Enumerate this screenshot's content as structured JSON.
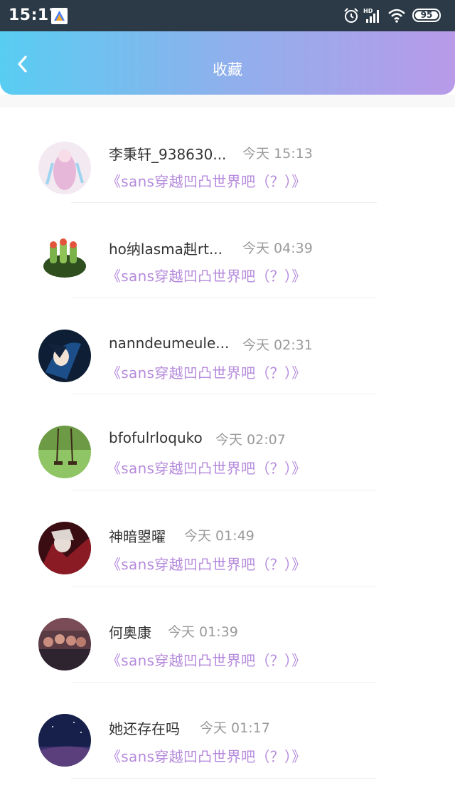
{
  "status_bar": {
    "time": "15:17",
    "signal_label": "HD",
    "battery": "95"
  },
  "header": {
    "title": "收藏",
    "back_icon": "chevron-left-icon"
  },
  "items": [
    {
      "name": "李秉轩_938630...",
      "time": "今天 15:13",
      "title": "《sans穿越凹凸世界吧（？）》"
    },
    {
      "name": "ho纳lasma赳rt...",
      "time": "今天 04:39",
      "title": "《sans穿越凹凸世界吧（？）》"
    },
    {
      "name": "nanndeumeule...",
      "time": "今天 02:31",
      "title": "《sans穿越凹凸世界吧（？）》"
    },
    {
      "name": "bfofulrloquko",
      "time": "今天 02:07",
      "title": "《sans穿越凹凸世界吧（？）》"
    },
    {
      "name": "神暗曌曜",
      "time": "今天 01:49",
      "title": "《sans穿越凹凸世界吧（？）》"
    },
    {
      "name": "何奥康",
      "time": "今天 01:39",
      "title": "《sans穿越凹凸世界吧（？）》"
    },
    {
      "name": "她还存在吗",
      "time": "今天 01:17",
      "title": "《sans穿越凹凸世界吧（？）》"
    }
  ],
  "colors": {
    "header_gradient_start": "#58cdf2",
    "header_gradient_end": "#b89ae9",
    "title_accent": "#b58adc",
    "status_bar": "#2b3a46"
  }
}
